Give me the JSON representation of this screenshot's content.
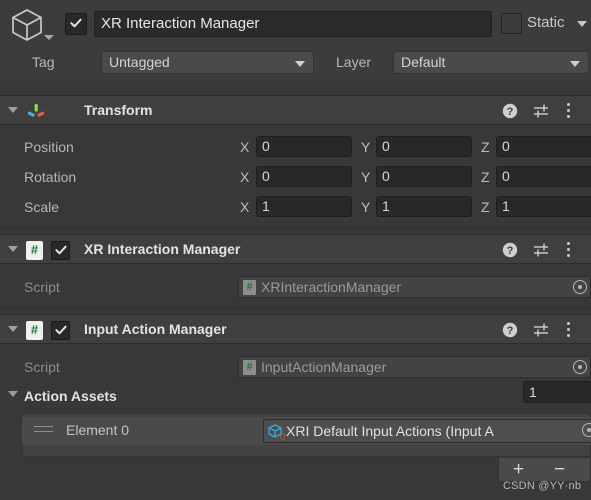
{
  "game_object": {
    "icon": "cube-icon",
    "enabled": true,
    "name": "XR Interaction Manager",
    "static_checked": false,
    "static_label": "Static",
    "tag_label": "Tag",
    "tag_value": "Untagged",
    "layer_label": "Layer",
    "layer_value": "Default"
  },
  "components": [
    {
      "title": "Transform",
      "icon": "transform-axis-icon",
      "expanded": true,
      "has_checkbox": false,
      "rows": [
        {
          "label": "Position",
          "x": "0",
          "y": "0",
          "z": "0"
        },
        {
          "label": "Rotation",
          "x": "0",
          "y": "0",
          "z": "0"
        },
        {
          "label": "Scale",
          "x": "1",
          "y": "1",
          "z": "1"
        }
      ],
      "axis_labels": {
        "x": "X",
        "y": "Y",
        "z": "Z"
      }
    },
    {
      "title": "XR Interaction Manager",
      "icon": "csharp-script-icon",
      "expanded": true,
      "has_checkbox": true,
      "enabled": true,
      "script_label": "Script",
      "script_value": "XRInteractionManager"
    },
    {
      "title": "Input Action Manager",
      "icon": "csharp-script-icon",
      "expanded": true,
      "has_checkbox": true,
      "enabled": true,
      "script_label": "Script",
      "script_value": "InputActionManager"
    }
  ],
  "array_property": {
    "label": "Action Assets",
    "expanded": true,
    "size": "1",
    "elements": [
      {
        "label": "Element 0",
        "value": "XRI Default Input Actions (Input A"
      }
    ],
    "add_label": "+",
    "remove_label": "−"
  },
  "header_icons": {
    "help": "help-icon",
    "preset": "preset-icon",
    "menu": "kebab-menu-icon"
  },
  "watermark": "CSDN @YY·nb",
  "colors": {
    "background": "#383838",
    "header_bar": "#3f3f3f",
    "field": "#282828",
    "dropdown": "#4a4a4a",
    "text": "#c4c4c4",
    "script_green": "#1d7a2d",
    "axis_x": "#e8603c",
    "axis_y": "#8fdd4a",
    "axis_z": "#4ab4e8"
  }
}
